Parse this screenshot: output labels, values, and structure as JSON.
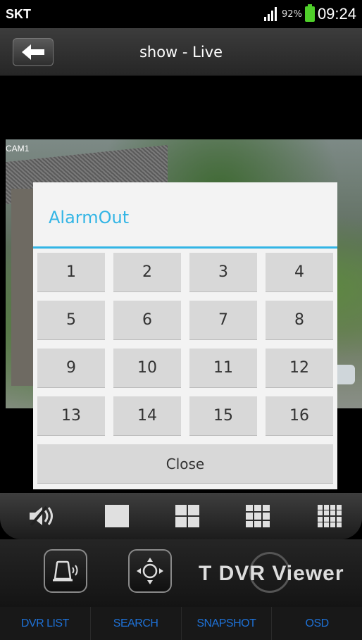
{
  "status_bar": {
    "carrier": "SKT",
    "battery_percent": "92%",
    "time": "09:24"
  },
  "header": {
    "title": "show - Live"
  },
  "video": {
    "camera_label": "CAM1"
  },
  "dialog": {
    "title": "AlarmOut",
    "keys": [
      "1",
      "2",
      "3",
      "4",
      "5",
      "6",
      "7",
      "8",
      "9",
      "10",
      "11",
      "12",
      "13",
      "14",
      "15",
      "16"
    ],
    "close_label": "Close"
  },
  "controls": {
    "icons": [
      "mute-speaker-icon",
      "single-view-icon",
      "quad-view-icon",
      "nine-view-icon",
      "sixteen-view-icon"
    ]
  },
  "panel": {
    "alarm_icon": "alarm-siren-icon",
    "ptz_icon": "ptz-move-icon",
    "logo_text": "T DVR Viewer"
  },
  "tabs": [
    {
      "label": "DVR LIST"
    },
    {
      "label": "SEARCH"
    },
    {
      "label": "SNAPSHOT"
    },
    {
      "label": "OSD"
    }
  ],
  "colors": {
    "accent": "#33b5e5",
    "tab_text": "#1e72d8",
    "battery": "#4fcf2a"
  }
}
